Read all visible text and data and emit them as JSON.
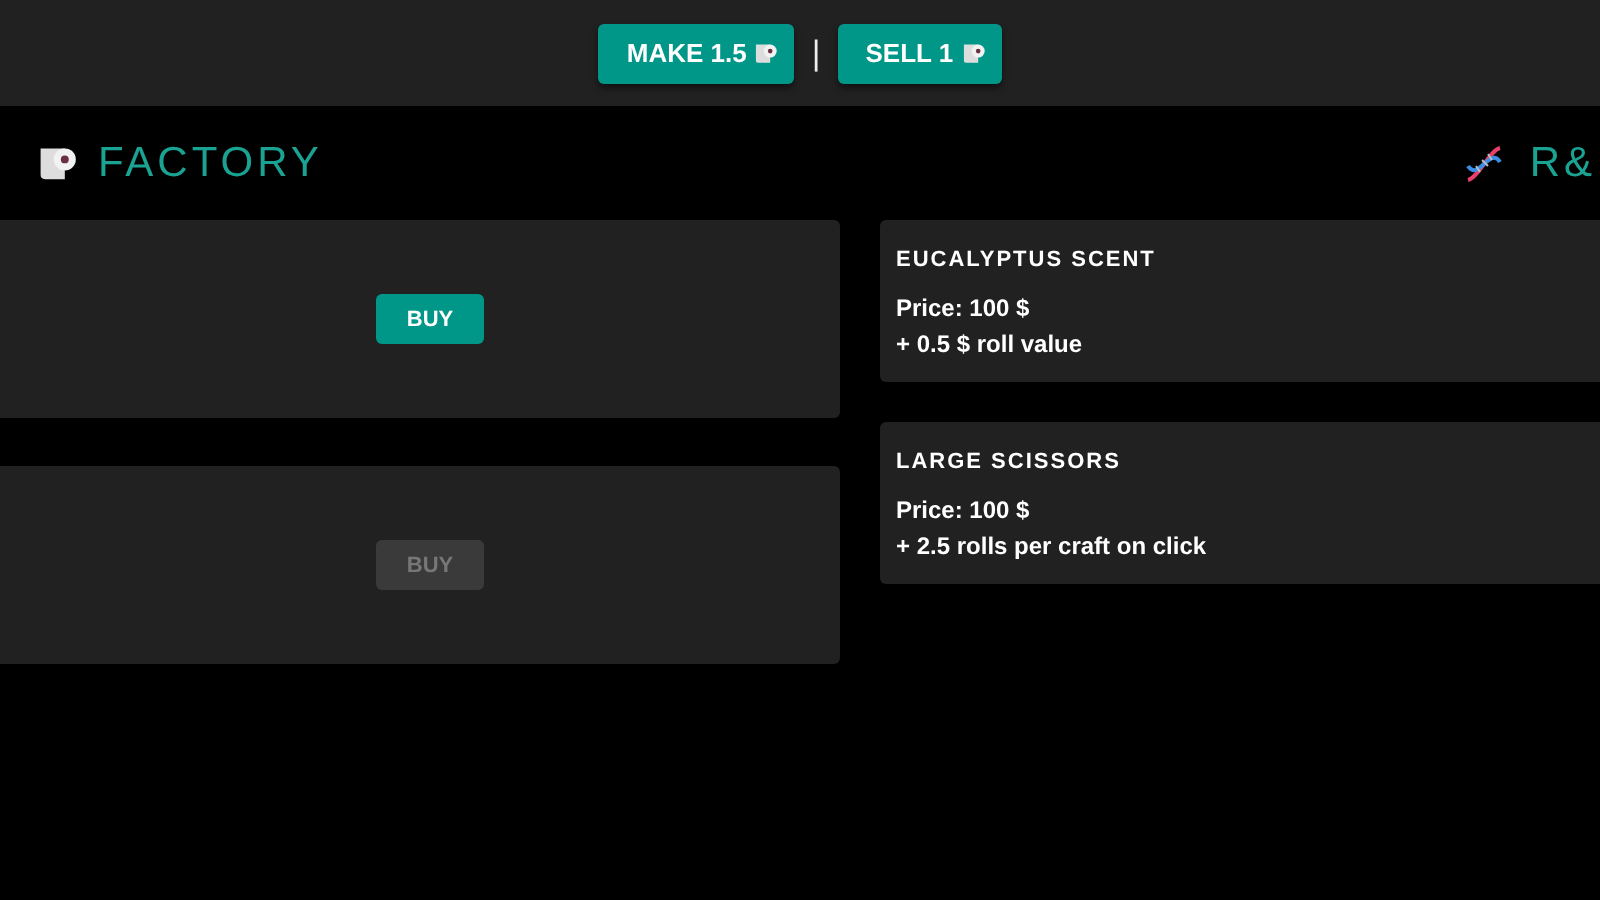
{
  "top_bar": {
    "buttons": [
      {
        "label": "MAKE 1.5"
      },
      {
        "label": "SELL 1"
      }
    ],
    "separator": "|"
  },
  "factory": {
    "title": "FACTORY",
    "items": [
      {
        "buy": {
          "label": "BUY",
          "disabled": false
        }
      },
      {
        "buy": {
          "label": "BUY",
          "disabled": true
        }
      }
    ]
  },
  "research": {
    "title": "R&",
    "items": [
      {
        "name": "EUCALYPTUS SCENT",
        "price": "Price: 100 $",
        "effect": "+ 0.5 $ roll value"
      },
      {
        "name": "LARGE SCISSORS",
        "price": "Price: 100 $",
        "effect": "+ 2.5 rolls per craft on click"
      }
    ]
  }
}
